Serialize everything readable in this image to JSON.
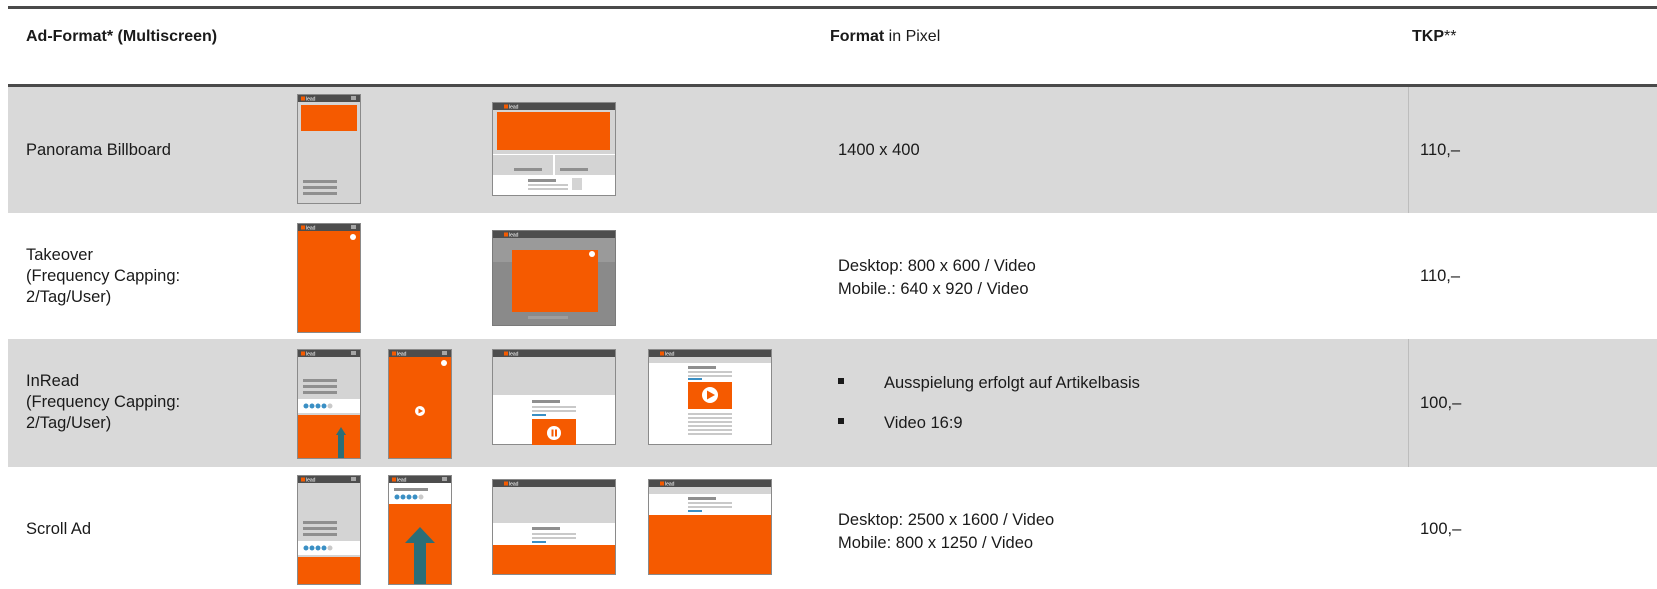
{
  "header": {
    "col1": "Ad-Format* (Multiscreen)",
    "col2_bold": "Format",
    "col2_rest": " in Pixel",
    "col3_bold": "TKP",
    "col3_rest": "**"
  },
  "icon_logo_text": "lead",
  "rows": [
    {
      "label": "Panorama Billboard",
      "format": "1400 x 400",
      "price": "110,–"
    },
    {
      "label": "Takeover\n(Frequency Capping:\n2/Tag/User)",
      "format": "Desktop: 800 x 600 / Video\nMobile.: 640 x 920 / Video",
      "price": "110,–"
    },
    {
      "label": "InRead\n(Frequency Capping:\n2/Tag/User)",
      "bullets": [
        "Ausspielung erfolgt auf Artikelbasis",
        "Video 16:9"
      ],
      "price": "100,–"
    },
    {
      "label": "Scroll Ad",
      "format": "Desktop: 2500 x 1600 / Video\nMobile: 800 x 1250 / Video",
      "price": "100,–"
    }
  ],
  "colors": {
    "orange": "#f55a00",
    "teal": "#2b6e77",
    "row_gray": "#d9d9d9",
    "rule": "#4a4a4a"
  }
}
